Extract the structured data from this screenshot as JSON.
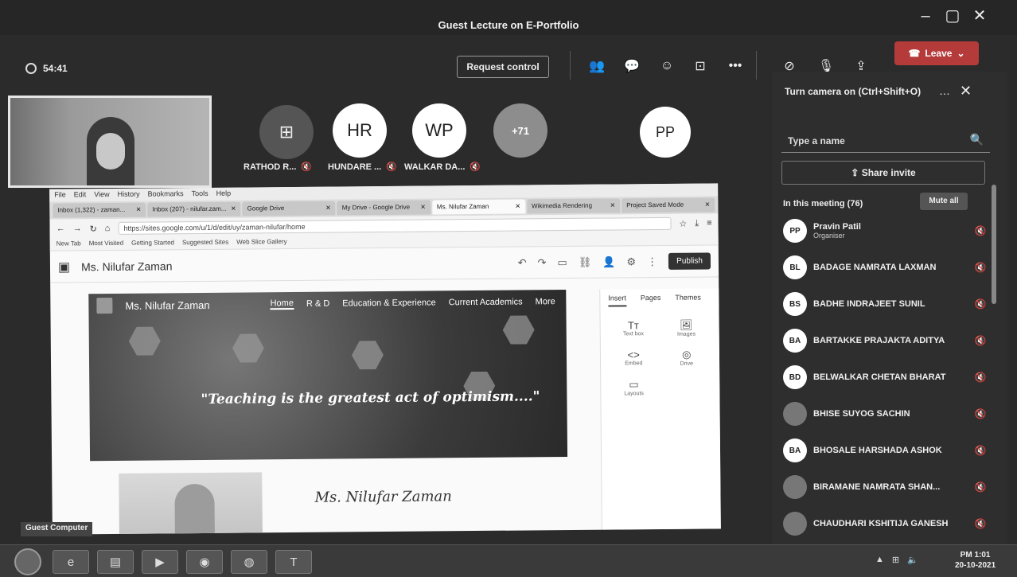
{
  "window": {
    "title": "Guest Lecture on E-Portfolio",
    "controls": {
      "minimize": "–",
      "maximize": "▢",
      "close": "✕"
    }
  },
  "toolbar": {
    "timer": "54:41",
    "request_control": "Request control",
    "leave_label": "Leave",
    "icons": [
      "people-icon",
      "chat-icon",
      "reactions-icon",
      "rooms-icon",
      "more-icon",
      "camera-off-icon",
      "mic-off-icon",
      "share-icon"
    ]
  },
  "stage": {
    "participants": [
      {
        "initials": "",
        "name": "RATHOD R..."
      },
      {
        "initials": "HR",
        "name": "HUNDARE ..."
      },
      {
        "initials": "WP",
        "name": "WALKAR DA..."
      },
      {
        "initials": "+71",
        "name": ""
      },
      {
        "initials": "PP",
        "name": ""
      }
    ],
    "guest_label": "Guest Computer"
  },
  "panel": {
    "title": "Turn camera on (Ctrl+Shift+O)",
    "search_placeholder": "Type a name",
    "share_invite": "Share invite",
    "in_meeting": "In this meeting (76)",
    "mute_all": "Mute all",
    "people": [
      {
        "initials": "PP",
        "name": "Pravin Patil",
        "role": "Organiser"
      },
      {
        "initials": "BL",
        "name": "BADAGE NAMRATA LAXMAN",
        "role": ""
      },
      {
        "initials": "BS",
        "name": "BADHE INDRAJEET SUNIL",
        "role": ""
      },
      {
        "initials": "BA",
        "name": "BARTAKKE PRAJAKTA ADITYA",
        "role": ""
      },
      {
        "initials": "BD",
        "name": "BELWALKAR CHETAN BHARAT",
        "role": ""
      },
      {
        "initials": "",
        "name": "BHISE SUYOG SACHIN",
        "role": ""
      },
      {
        "initials": "BA",
        "name": "BHOSALE HARSHADA ASHOK",
        "role": ""
      },
      {
        "initials": "",
        "name": "BIRAMANE NAMRATA SHAN...",
        "role": ""
      },
      {
        "initials": "",
        "name": "CHAUDHARI KSHITIJA GANESH",
        "role": ""
      }
    ]
  },
  "browser": {
    "menu": [
      "File",
      "Edit",
      "View",
      "History",
      "Bookmarks",
      "Tools",
      "Help"
    ],
    "tabs": [
      {
        "label": "Inbox (1,322) - zaman...",
        "active": false
      },
      {
        "label": "Inbox (207) - nilufar.zam...",
        "active": false
      },
      {
        "label": "Google Drive",
        "active": false
      },
      {
        "label": "My Drive - Google Drive",
        "active": false
      },
      {
        "label": "Ms. Nilufar Zaman",
        "active": true
      },
      {
        "label": "Wikimedia Rendering",
        "active": false
      },
      {
        "label": "Project Saved Mode",
        "active": false
      }
    ],
    "url": "https://sites.google.com/u/1/d/edit/uy/zaman-nilufar/home",
    "bookmarks": [
      "New Tab",
      "Most Visited",
      "Getting Started",
      "Suggested Sites",
      "Web Slice Gallery"
    ],
    "site_title": "Ms. Nilufar Zaman",
    "publish": "Publish",
    "hero": {
      "brand": "Ms. Nilufar Zaman",
      "nav": [
        "Home",
        "R & D",
        "Education & Experience",
        "Current Academics",
        "More"
      ],
      "quote": "\"Teaching is the greatest act of optimism....\""
    },
    "profile_name": "Ms. Nilufar Zaman",
    "insert_panel": {
      "tabs": [
        "Insert",
        "Pages",
        "Themes"
      ],
      "items": [
        {
          "glyph": "Tт",
          "label": "Text box"
        },
        {
          "glyph": "🖼",
          "label": "Images"
        },
        {
          "glyph": "<>",
          "label": "Embed"
        },
        {
          "glyph": "◎",
          "label": "Drive"
        },
        {
          "glyph": "▭",
          "label": "Layouts"
        }
      ]
    }
  },
  "taskbar": {
    "time": "PM 1:01",
    "date": "20-10-2021"
  }
}
